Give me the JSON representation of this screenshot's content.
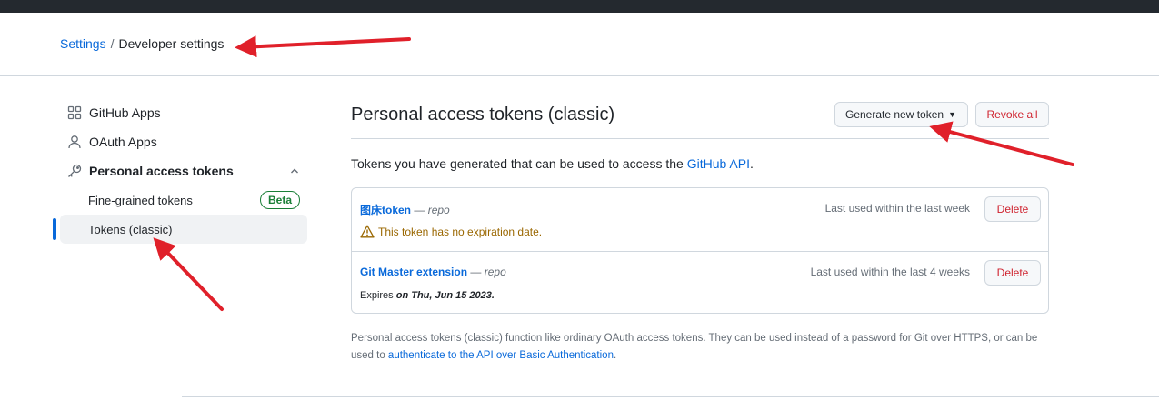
{
  "breadcrumb": {
    "root": "Settings",
    "separator": "/",
    "current": "Developer settings"
  },
  "sidebar": {
    "items": [
      {
        "label": "GitHub Apps",
        "icon": "apps-icon"
      },
      {
        "label": "OAuth Apps",
        "icon": "person-icon"
      },
      {
        "label": "Personal access tokens",
        "icon": "key-icon",
        "expanded": true
      }
    ],
    "subitems": [
      {
        "label": "Fine-grained tokens",
        "badge": "Beta"
      },
      {
        "label": "Tokens (classic)",
        "active": true
      }
    ]
  },
  "main": {
    "title": "Personal access tokens (classic)",
    "generate_label": "Generate new token",
    "revoke_label": "Revoke all",
    "intro_text": "Tokens you have generated that can be used to access the ",
    "intro_link": "GitHub API",
    "intro_end": ".",
    "tokens": [
      {
        "name": "图床token",
        "dash": "—",
        "scope": "repo",
        "last_used": "Last used within the last week",
        "delete_label": "Delete",
        "warning": "This token has no expiration date."
      },
      {
        "name": "Git Master extension",
        "dash": "—",
        "scope": "repo",
        "last_used": "Last used within the last 4 weeks",
        "delete_label": "Delete",
        "expires_prefix": "Expires ",
        "expires_date": "on Thu, Jun 15 2023",
        "expires_suffix": "."
      }
    ],
    "footnote_text": "Personal access tokens (classic) function like ordinary OAuth access tokens. They can be used instead of a password for Git over HTTPS, or can be used to ",
    "footnote_link": "authenticate to the API over Basic Authentication",
    "footnote_end": "."
  },
  "colors": {
    "link": "#0969da",
    "danger": "#cf222e",
    "success": "#1a7f37",
    "warning": "#9a6700",
    "annotation_arrow": "#e0202a"
  }
}
